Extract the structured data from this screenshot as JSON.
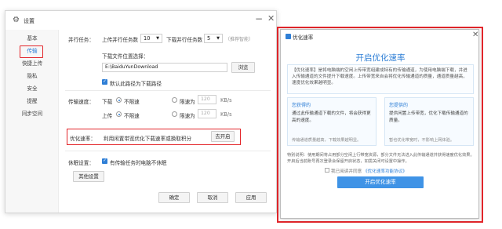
{
  "settings": {
    "title": "设置",
    "sidebar": [
      "基本",
      "传输",
      "快捷上传",
      "隐私",
      "安全",
      "提醒",
      "同步空间"
    ],
    "transfer_tasks": {
      "label": "并行任务：",
      "upload_label": "上传并行任务数",
      "upload_value": "10",
      "download_label": "下载并行任务数",
      "download_value": "5",
      "hint": "（推荐智能）"
    },
    "download_location": {
      "label": "下载文件位置选择：",
      "path": "E:\\BaiduYunDownload",
      "browse": "浏览",
      "default_check": "默认此路径为下载路径"
    },
    "speed": {
      "label": "传输速度：",
      "download_label": "下载",
      "upload_label": "上传",
      "unlimited": "不限速",
      "limited": "限速为",
      "download_limit": "120",
      "upload_limit": "120",
      "unit": "KB/s"
    },
    "optimize": {
      "label": "优化速率：",
      "text": "利用闲置带宽优化下载速率或换取积分",
      "button": "去开启"
    },
    "sleep": {
      "label": "休眠设置：",
      "check": "有传输任务时电脑不休眠",
      "other_button": "其他设置"
    },
    "footer": {
      "ok": "确定",
      "cancel": "取消",
      "apply": "应用"
    }
  },
  "dialog": {
    "title": "优化速率",
    "heading": "开启优化速率",
    "description": "【优化速率】是将电脑端的空闲上传带宽组建成特有的传输通道，为使用电脑端下载，并进入传输通道的文件提升下载速度。上传带宽来自会将优化传输通道的质量，通道质量越高，速度优化效果越明显。",
    "card_left": {
      "title": "您获得的",
      "body": "通过此传输通道下载的文件，将会获得更高的速度。",
      "foot": "传输通道质量越高，下载效果越明显。"
    },
    "card_right": {
      "title": "您提供的",
      "body": "提供闲置上传带宽，优化下载传输通道的质量。",
      "foot": "暂也优化带宽时，不影响上网体验。"
    },
    "note": "特别说明：使用期间将占用部分空闲上行带宽资源，部分文件无法进入此传输通道并获得速度优化效果。开启后当前账号再次登录会保留开启状态，如需关闭可设置中操作。",
    "agree_prefix": "我已阅读并同意",
    "agree_link": "《优化速率功能协议》",
    "start_button": "开启优化速率"
  }
}
